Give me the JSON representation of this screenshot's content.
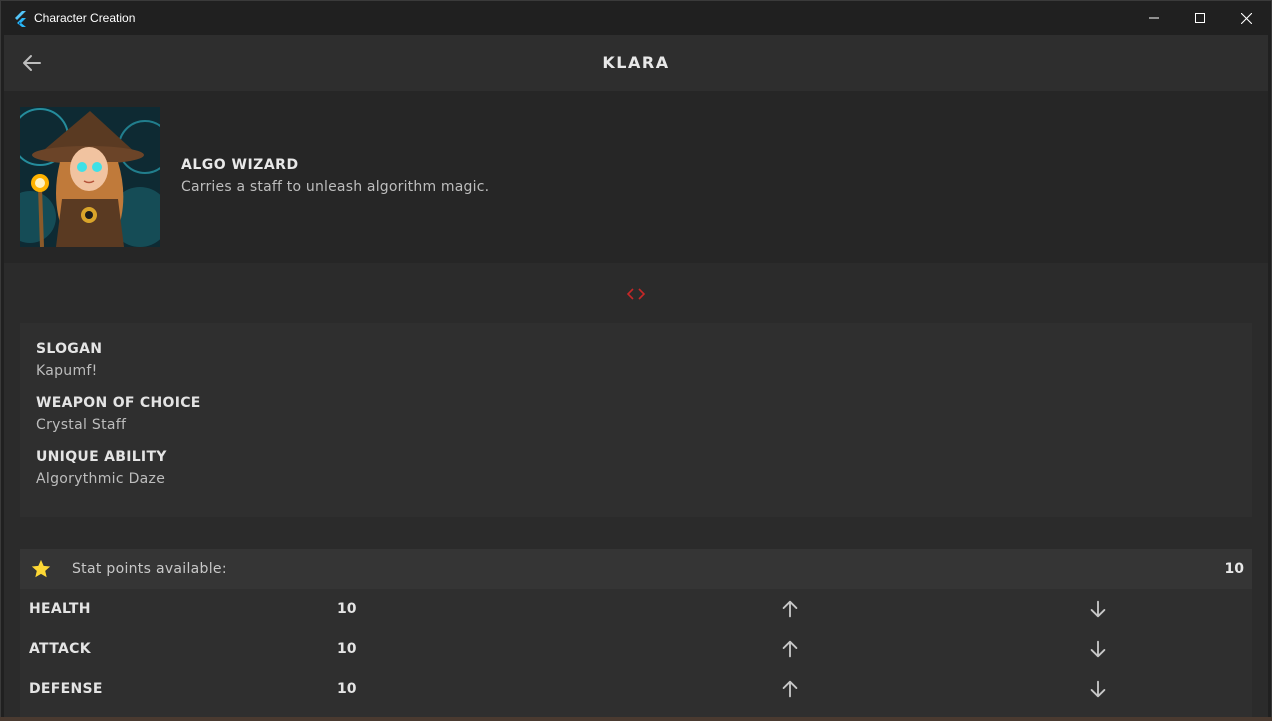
{
  "window": {
    "title": "Character Creation",
    "icons": {
      "app": "flutter-logo-icon",
      "minimize": "minimize-icon",
      "maximize": "maximize-icon",
      "close": "close-icon"
    }
  },
  "appbar": {
    "title": "KLARA",
    "back_icon": "arrow-back-icon"
  },
  "character_class": {
    "name": "ALGO WIZARD",
    "description": "Carries a staff to unleash algorithm magic.",
    "portrait": "wizard-portrait"
  },
  "divider_icon": "code-icon",
  "details": [
    {
      "label": "SLOGAN",
      "value": "Kapumf!"
    },
    {
      "label": "WEAPON OF CHOICE",
      "value": "Crystal Staff"
    },
    {
      "label": "UNIQUE ABILITY",
      "value": "Algorythmic Daze"
    }
  ],
  "stats": {
    "points_label": "Stat points available:",
    "points_value": "10",
    "star_icon": "star-icon",
    "rows": [
      {
        "name": "HEALTH",
        "value": "10"
      },
      {
        "name": "ATTACK",
        "value": "10"
      },
      {
        "name": "DEFENSE",
        "value": "10"
      }
    ]
  },
  "colors": {
    "accent_red": "#c62828",
    "star_yellow": "#fdd835",
    "flutter_blue": "#42a5f5"
  }
}
